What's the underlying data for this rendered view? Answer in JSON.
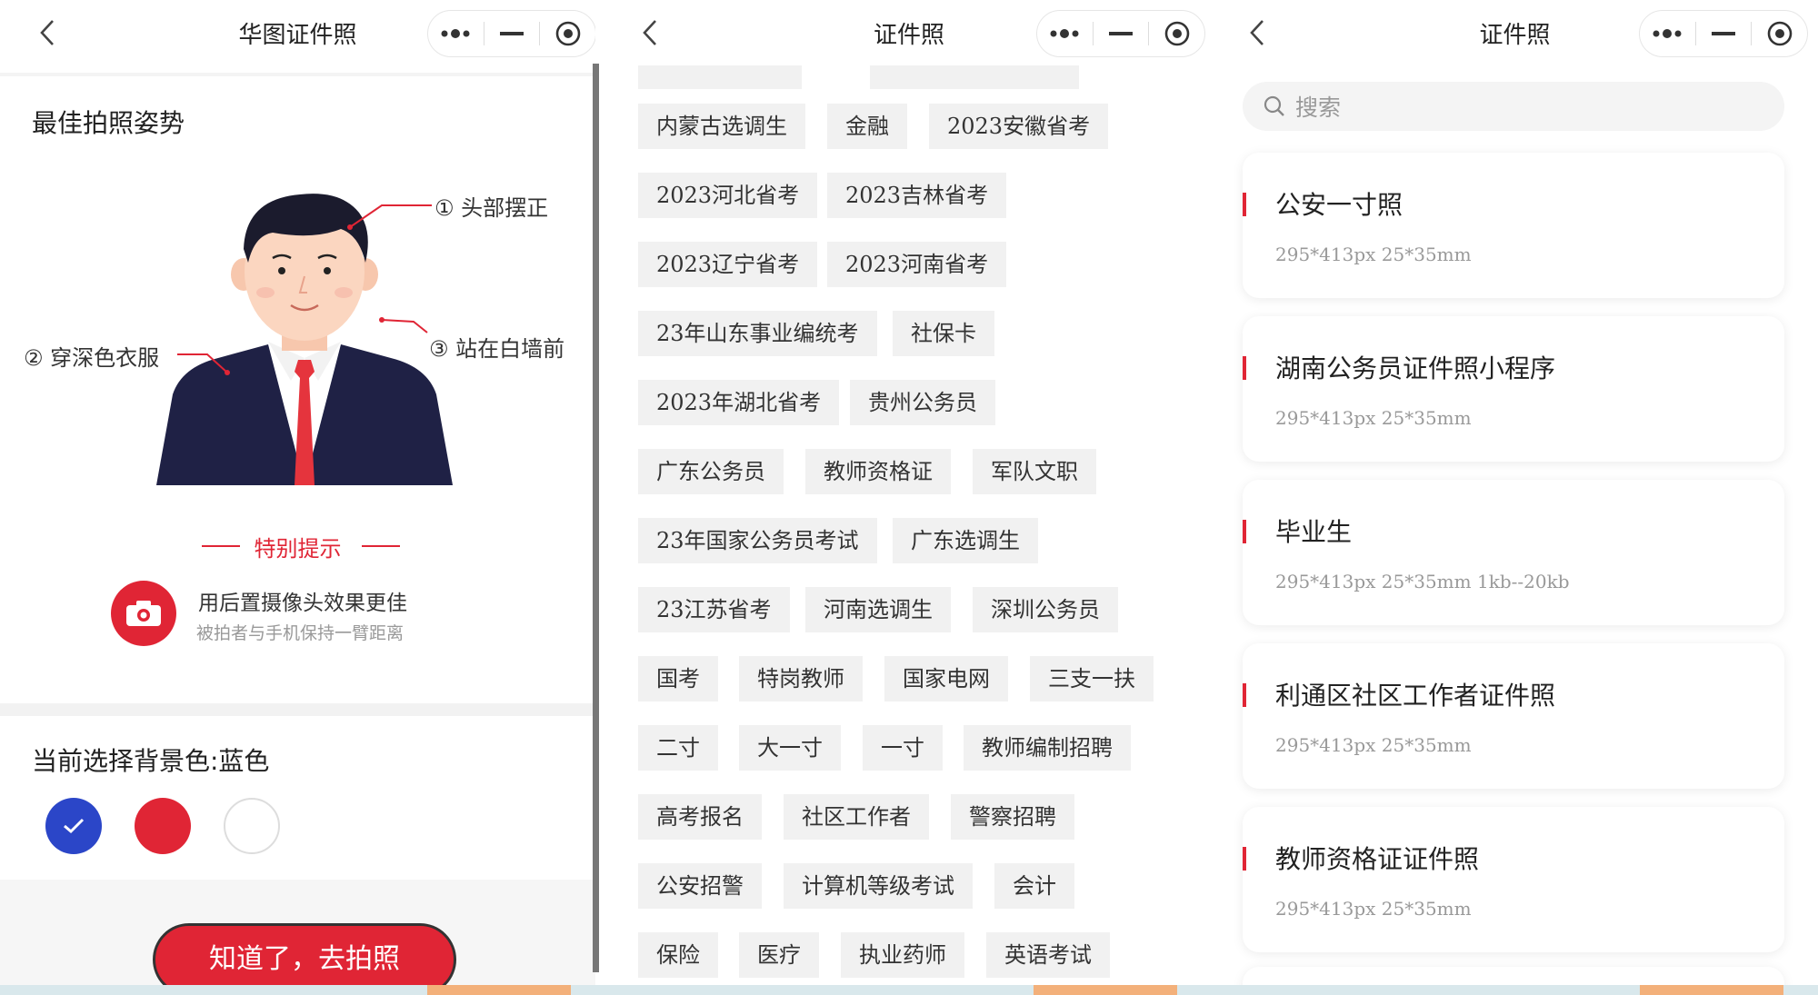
{
  "panel1": {
    "title": "华图证件照",
    "pose_title": "最佳拍照姿势",
    "callouts": {
      "head": "① 头部摆正",
      "clothes": "② 穿深色衣服",
      "wall": "③ 站在白墙前"
    },
    "tip_title": "特别提示",
    "tip_main": "用后置摄像头效果更佳",
    "tip_sub": "被拍者与手机保持一臂距离",
    "bg_label": "当前选择背景色:蓝色",
    "swatches": [
      {
        "name": "blue",
        "color": "#2b46c8",
        "selected": true
      },
      {
        "name": "red",
        "color": "#e02535",
        "selected": false
      },
      {
        "name": "white",
        "color": "#ffffff",
        "selected": false
      }
    ],
    "button_label": "知道了，去拍照"
  },
  "panel2": {
    "title": "证件照",
    "tags": [
      "内蒙古选调生",
      "金融",
      "2023安徽省考",
      "2023河北省考",
      "2023吉林省考",
      "2023辽宁省考",
      "2023河南省考",
      "23年山东事业编统考",
      "社保卡",
      "2023年湖北省考",
      "贵州公务员",
      "广东公务员",
      "教师资格证",
      "军队文职",
      "23年国家公务员考试",
      "广东选调生",
      "23江苏省考",
      "河南选调生",
      "深圳公务员",
      "国考",
      "特岗教师",
      "国家电网",
      "三支一扶",
      "二寸",
      "大一寸",
      "一寸",
      "教师编制招聘",
      "高考报名",
      "社区工作者",
      "警察招聘",
      "公安招警",
      "计算机等级考试",
      "会计",
      "保险",
      "医疗",
      "执业药师",
      "英语考试"
    ]
  },
  "panel3": {
    "title": "证件照",
    "search_placeholder": "搜索",
    "cards": [
      {
        "title": "公安一寸照",
        "spec": "295*413px  25*35mm"
      },
      {
        "title": "湖南公务员证件照小程序",
        "spec": "295*413px  25*35mm"
      },
      {
        "title": "毕业生",
        "spec": "295*413px  25*35mm  1kb--20kb"
      },
      {
        "title": "利通区社区工作者证件照",
        "spec": "295*413px  25*35mm"
      },
      {
        "title": "教师资格证证件照",
        "spec": "295*413px  25*35mm"
      }
    ]
  },
  "colors": {
    "accent": "#e02535",
    "selected_blue": "#2b46c8",
    "tag_bg": "#f1f1f1"
  },
  "icons": [
    "back-arrow-icon",
    "more-dots-icon",
    "minimize-icon",
    "close-target-icon",
    "camera-icon",
    "check-icon",
    "search-icon"
  ]
}
